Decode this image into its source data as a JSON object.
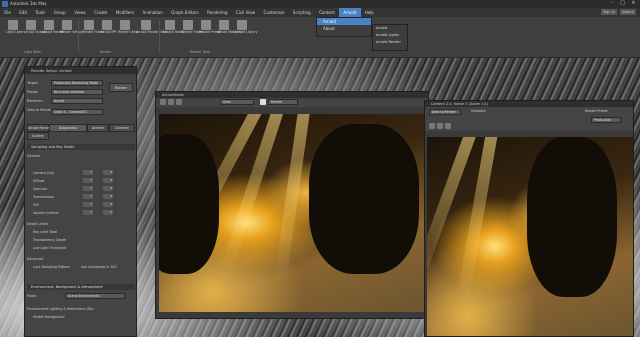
{
  "window": {
    "title": "Autodesk 3ds Max"
  },
  "menu": [
    "File",
    "Edit",
    "Tools",
    "Group",
    "Views",
    "Create",
    "Modifiers",
    "Animation",
    "Graph Editors",
    "Rendering",
    "Civil View",
    "Customize",
    "Scripting",
    "Content",
    "Arnold",
    "Help"
  ],
  "user": {
    "account": "Sign In",
    "search": "Search"
  },
  "dropdown": {
    "items": [
      "Arnold",
      "About"
    ],
    "submenu": [
      "Arnold",
      "Arnold Lights",
      "Arnold Render"
    ]
  },
  "ribbon": {
    "groups": [
      "Light Tools",
      "Render",
      "Render Tools"
    ],
    "buttons": [
      {
        "label": "Light\nLister"
      },
      {
        "label": "Arnold\nShapes"
      },
      {
        "label": "Arnold\nRender"
      },
      {
        "label": "Render\nSetup"
      },
      {
        "label": "Render\nFrame"
      },
      {
        "label": "Arnold\nIPR"
      },
      {
        "label": "Render\nView"
      },
      {
        "label": "Arnold\nRender View"
      },
      {
        "label": "Create\nBatch"
      },
      {
        "label": "Render\nFrame"
      },
      {
        "label": "Render\nPreset"
      },
      {
        "label": "Arnold\nMaterial"
      },
      {
        "label": "Arnold\nLibrary"
      }
    ]
  },
  "render_setup": {
    "title": "Render Setup: Arnold",
    "target_label": "Target:",
    "target_value": "Production Rendering Mode",
    "preset_label": "Preset:",
    "preset_value": "No preset selected",
    "renderer_label": "Renderer:",
    "renderer_value": "Arnold",
    "view_label": "View to Render:",
    "view_value": "Quad 4 - Camera001",
    "render_button": "Render",
    "tabs": [
      "Arnold Renderer",
      "Diagnostics",
      "Archive",
      "Common",
      "System"
    ],
    "sections": [
      "Sampling and Ray Depth",
      "Environment, Background & Atmosphere"
    ],
    "rows": [
      {
        "label": "General",
        "a": "",
        "b": ""
      },
      {
        "label": "Camera (AA)",
        "a": "3",
        "b": "9"
      },
      {
        "label": "Diffuse",
        "a": "2",
        "b": "4"
      },
      {
        "label": "Specular",
        "a": "2",
        "b": "4"
      },
      {
        "label": "Transmission",
        "a": "2",
        "b": "4"
      },
      {
        "label": "SSS",
        "a": "2",
        "b": "4"
      },
      {
        "label": "Volume Indirect",
        "a": "2",
        "b": "0"
      }
    ],
    "depth_label": "Depth Limits",
    "ray_limit": "Ray Limit Total",
    "transparency": "Transparency Depth",
    "low_light": "Low Light Threshold",
    "advanced": "Advanced",
    "lock_sampling": "Lock Sampling Pattern",
    "use_autobump": "Use Autobump in SSS",
    "mode_label": "Mode:",
    "mode_value": "Scene Environment",
    "env_lighting": "Environment Lighting & Reflections (IBL)",
    "visible_bg": "Visible Background"
  },
  "render_window_1": {
    "title": "ActiveShade",
    "area_value": "View",
    "preset_value": "Render"
  },
  "render_window_2": {
    "title": "Camera 2:2, frame 0 (Zoom 1:1)",
    "area_value": "Area to Render",
    "viewport_label": "Viewport:",
    "preset_label": "Render Preset:",
    "preset_value": "Production"
  }
}
